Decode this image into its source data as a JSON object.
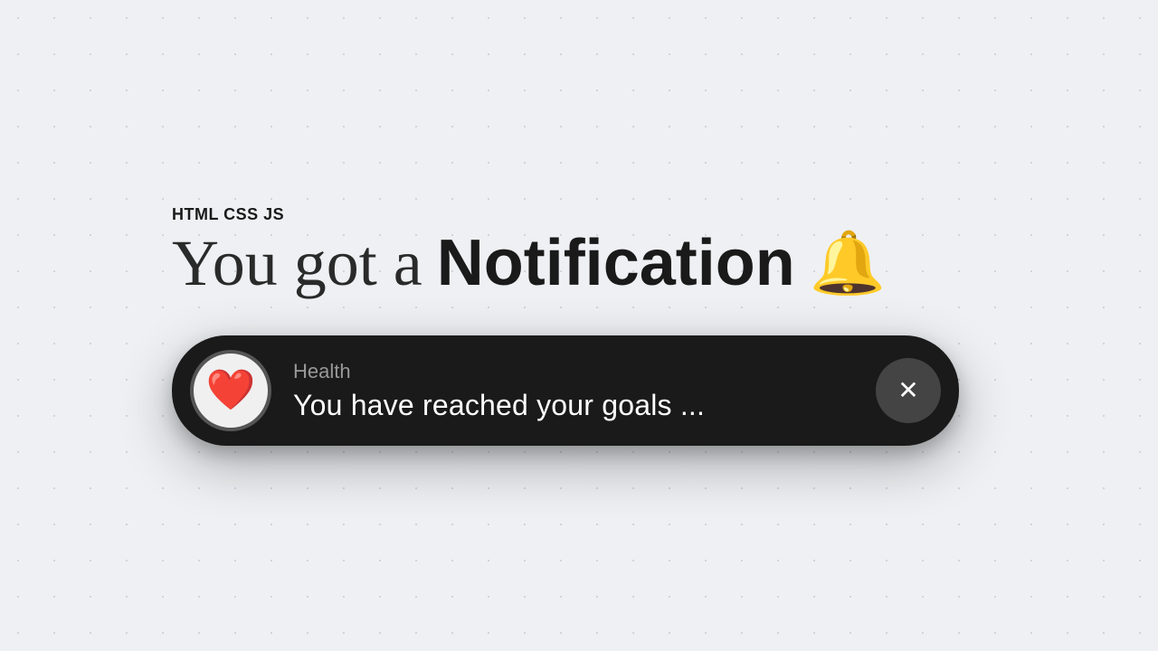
{
  "page": {
    "background_color": "#eef0f3"
  },
  "header": {
    "tech_label": "HTML CSS JS",
    "title_prefix": "You got a ",
    "title_bold": "Notification",
    "bell_icon": "🔔"
  },
  "notification": {
    "category": "Health",
    "message": "You have reached your goals ...",
    "heart_icon": "❤️",
    "close_label": "✕"
  }
}
